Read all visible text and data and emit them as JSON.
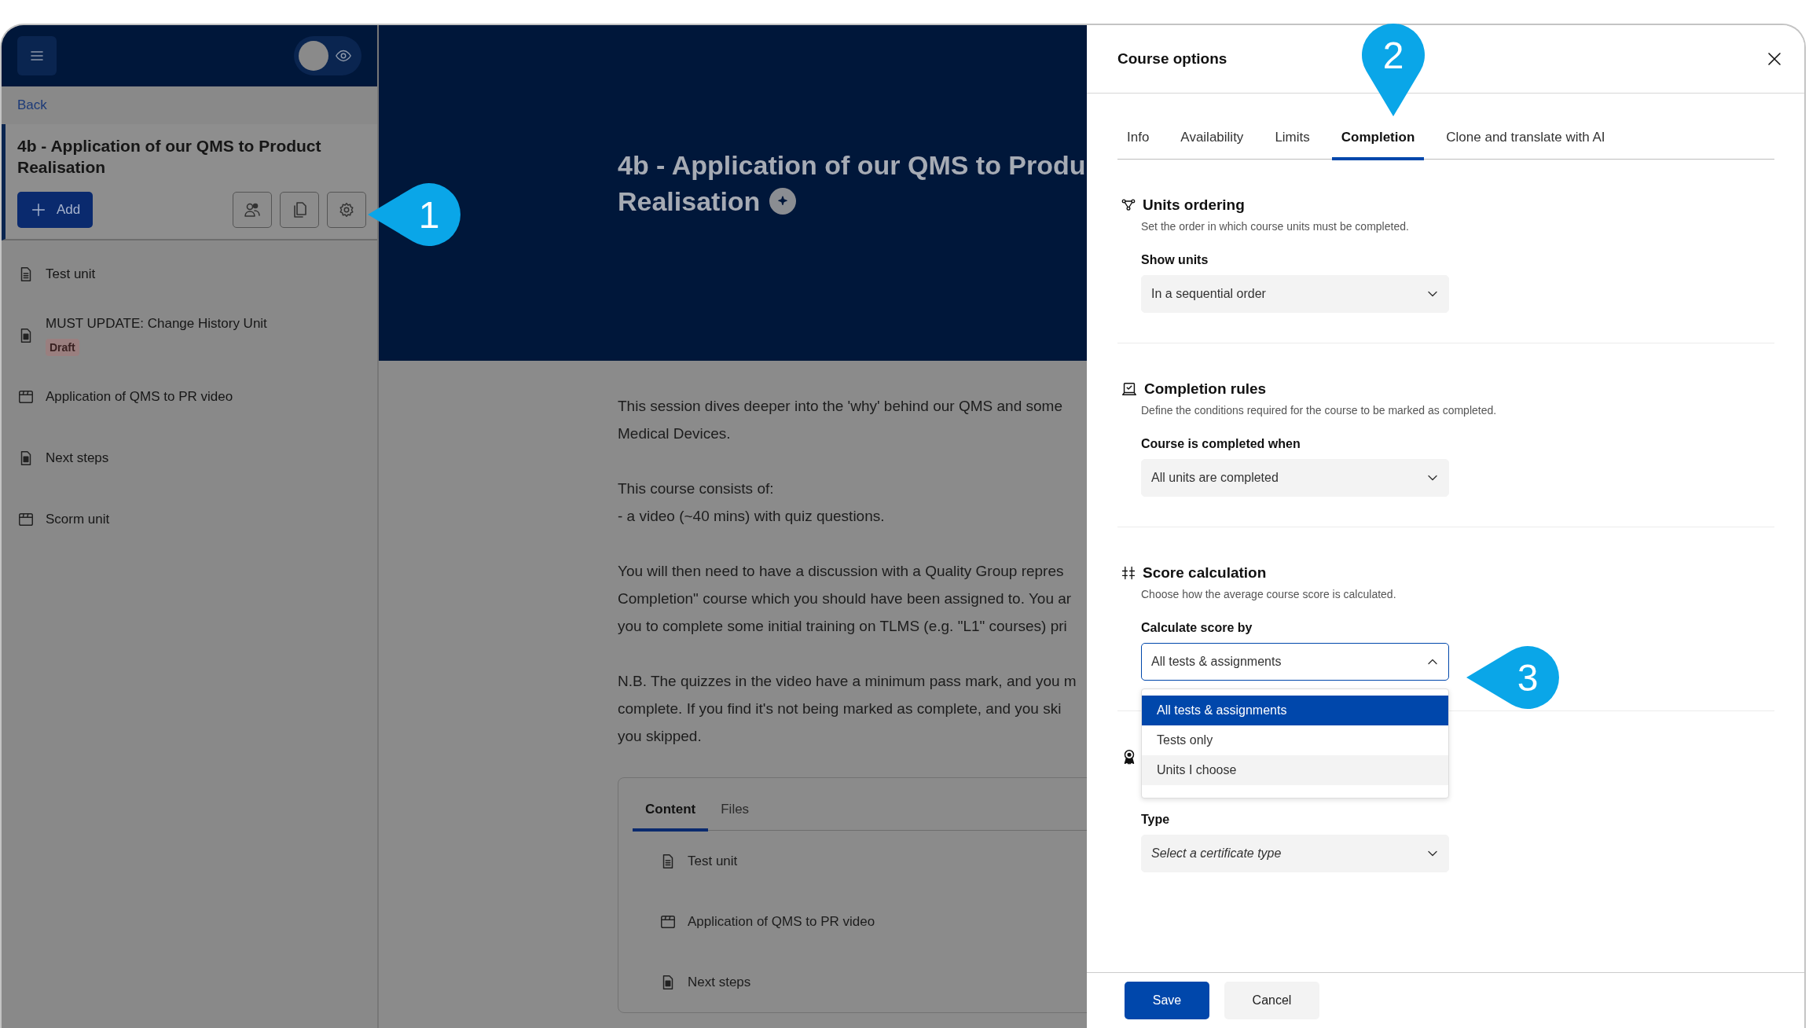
{
  "sidebar": {
    "preview_toggle": {
      "on": false
    },
    "back": "Back",
    "course_title": "4b - Application of our QMS to Product Realisation",
    "add_button": "Add",
    "units": [
      {
        "kind": "document",
        "title": "Test unit"
      },
      {
        "kind": "page",
        "title": "MUST UPDATE: Change History Unit",
        "badge": "Draft"
      },
      {
        "kind": "media",
        "title": "Application of QMS to PR video"
      },
      {
        "kind": "page",
        "title": "Next steps"
      },
      {
        "kind": "media",
        "title": "Scorm unit"
      }
    ]
  },
  "banner": {
    "title_lines": [
      "4b - Application of our QMS to Produ",
      "Realisation"
    ]
  },
  "description": [
    {
      "lines": [
        "This session dives deeper into the 'why' behind our QMS and some",
        "Medical Devices."
      ]
    },
    {
      "lines": [
        "This course consists of:",
        "- a video (~40 mins) with quiz questions."
      ]
    },
    {
      "lines": [
        "You will then need to have a discussion with a Quality Group repres",
        "Completion\" course which you should have been assigned to. You ar",
        "you to complete some initial training on TLMS (e.g. \"L1\" courses) pri"
      ]
    },
    {
      "lines": [
        "N.B. The quizzes in the video have a minimum pass mark, and you m",
        "complete. If you find it's not being marked as complete, and you ski",
        "you skipped."
      ]
    }
  ],
  "content_card": {
    "tabs": [
      {
        "label": "Content",
        "selected": true
      },
      {
        "label": "Files",
        "selected": false
      }
    ],
    "units": [
      {
        "kind": "document",
        "title": "Test unit"
      },
      {
        "kind": "media",
        "title": "Application of QMS to PR video"
      },
      {
        "kind": "page",
        "title": "Next steps"
      }
    ]
  },
  "drawer": {
    "title": "Course options",
    "tabs": [
      {
        "label": "Info",
        "selected": false
      },
      {
        "label": "Availability",
        "selected": false
      },
      {
        "label": "Limits",
        "selected": false
      },
      {
        "label": "Completion",
        "selected": true
      },
      {
        "label": "Clone and translate with AI",
        "selected": false
      }
    ],
    "sections": [
      {
        "kind": "ordering",
        "title": "Units ordering",
        "description": "Set the order in which course units must be completed.",
        "field_label": "Show units",
        "value": "In a sequential order"
      },
      {
        "kind": "rules",
        "title": "Completion rules",
        "description": "Define the conditions required for the course to be marked as completed.",
        "field_label": "Course is completed when",
        "value": "All units are completed"
      },
      {
        "kind": "score",
        "title": "Score calculation",
        "description": "Choose how the average course score is calculated.",
        "field_label": "Calculate score by",
        "value": "All tests & assignments",
        "expanded": true,
        "options": [
          {
            "label": "All tests & assignments",
            "selected": true,
            "highlighted": false
          },
          {
            "label": "Tests only",
            "selected": false,
            "highlighted": false
          },
          {
            "label": "Units I choose",
            "selected": false,
            "highlighted": true
          }
        ]
      },
      {
        "kind": "certificate",
        "field_label": "Type",
        "placeholder": "Select a certificate type"
      }
    ],
    "save_button": "Save",
    "cancel_button": "Cancel"
  },
  "callouts": [
    {
      "number": "1",
      "kind": "left"
    },
    {
      "number": "2",
      "kind": "down"
    },
    {
      "number": "3",
      "kind": "left"
    }
  ]
}
